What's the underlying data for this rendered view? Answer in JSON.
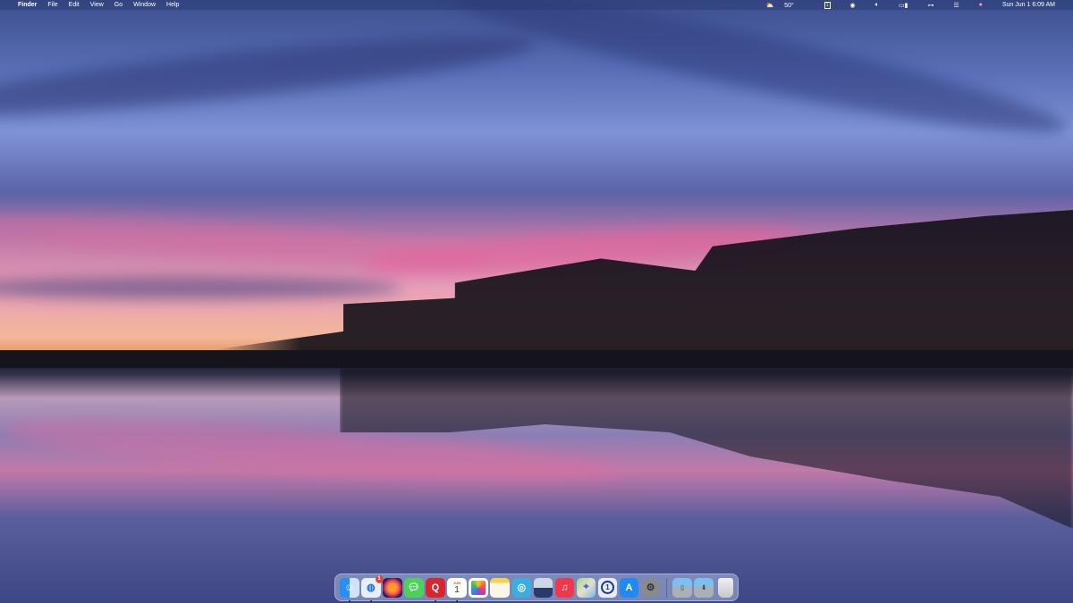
{
  "menubar": {
    "apple": "",
    "app": "Finder",
    "items": [
      "File",
      "Edit",
      "View",
      "Go",
      "Window",
      "Help"
    ],
    "status": {
      "weather": "50°",
      "datetime": "Sun Jun 1  6:09 AM"
    }
  },
  "dock": {
    "apps": [
      {
        "name": "Finder",
        "running": true
      },
      {
        "name": "Thunderbird",
        "running": true,
        "badge": "1"
      },
      {
        "name": "Firefox",
        "running": false
      },
      {
        "name": "Messages",
        "running": false
      },
      {
        "name": "Quip",
        "running": true,
        "glyph": "Q"
      },
      {
        "name": "Calendar",
        "running": true,
        "month": "JUN",
        "day": "1"
      },
      {
        "name": "Photos",
        "running": false
      },
      {
        "name": "Notes",
        "running": false
      },
      {
        "name": "Edge",
        "running": false
      },
      {
        "name": "Preview",
        "running": false
      },
      {
        "name": "Music",
        "running": false,
        "glyph": "♫"
      },
      {
        "name": "Maps",
        "running": false
      },
      {
        "name": "1Password",
        "running": false,
        "glyph": "1"
      },
      {
        "name": "App Store",
        "running": false,
        "glyph": "A"
      },
      {
        "name": "System Settings",
        "running": false,
        "glyph": "⚙"
      }
    ],
    "folders": [
      {
        "name": "Documents"
      },
      {
        "name": "Downloads"
      }
    ],
    "trash": "Trash"
  }
}
